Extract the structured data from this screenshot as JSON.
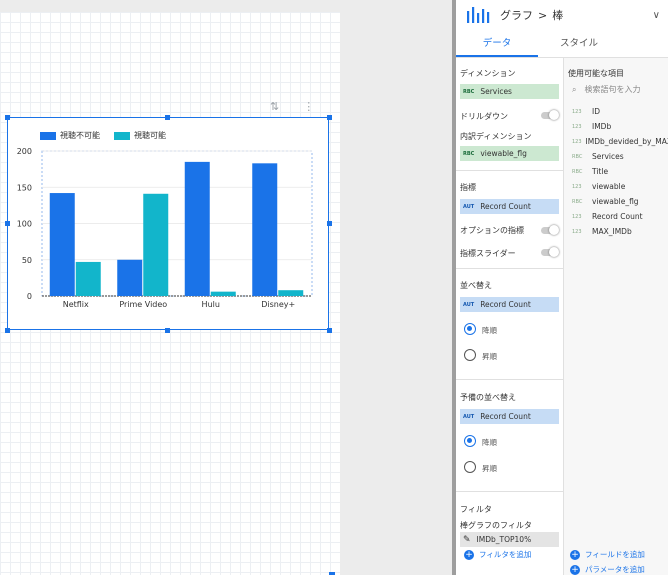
{
  "chart_data": {
    "type": "bar",
    "categories": [
      "Netflix",
      "Prime Video",
      "Hulu",
      "Disney+"
    ],
    "series": [
      {
        "name": "視聴不可能",
        "values": [
          142,
          50,
          185,
          183
        ],
        "color": "#1a73e8"
      },
      {
        "name": "視聴可能",
        "values": [
          47,
          141,
          6,
          8
        ],
        "color": "#12b5cb"
      }
    ],
    "yticks": [
      0,
      50,
      100,
      150,
      200
    ],
    "ylim": [
      0,
      200
    ],
    "legend_position": "top-left"
  },
  "panel": {
    "breadcrumb_chart": "グラフ",
    "breadcrumb_sep": ">",
    "breadcrumb_type": "棒",
    "tabs": [
      "データ",
      "スタイル"
    ],
    "dimension_title": "ディメンション",
    "dimension_value": "Services",
    "drilldown_label": "ドリルダウン",
    "breakdown_title": "内訳ディメンション",
    "breakdown_value": "viewable_flg",
    "metric_title": "指標",
    "metric_value": "Record Count",
    "optional_metric_label": "オプションの指標",
    "metric_slider_label": "指標スライダー",
    "sort_title": "並べ替え",
    "sort_value": "Record Count",
    "sort_desc": "降順",
    "sort_asc": "昇順",
    "secondary_sort_title": "予備の並べ替え",
    "secondary_sort_value": "Record Count",
    "secondary_desc": "降順",
    "secondary_asc": "昇順",
    "filter_title": "フィルタ",
    "bar_filter_title": "棒グラフのフィルタ",
    "filter_value": "IMDb_TOP10%",
    "add_filter": "フィルタを追加",
    "available_title": "使用可能な項目",
    "search_placeholder": "検索語句を入力",
    "fields": [
      {
        "tag": "123",
        "name": "ID"
      },
      {
        "tag": "123",
        "name": "IMDb"
      },
      {
        "tag": "123",
        "name": "IMDb_devided_by_MAX"
      },
      {
        "tag": "RBC",
        "name": "Services"
      },
      {
        "tag": "RBC",
        "name": "Title"
      },
      {
        "tag": "123",
        "name": "viewable"
      },
      {
        "tag": "RBC",
        "name": "viewable_flg"
      },
      {
        "tag": "123",
        "name": "Record Count"
      },
      {
        "tag": "123",
        "name": "MAX_IMDb"
      }
    ],
    "add_field": "フィールドを追加",
    "add_parameter": "パラメータを追加",
    "tag_rbc": "RBC",
    "tag_aut": "AUT"
  },
  "colors": {
    "accent": "#1a73e8",
    "teal": "#12b5cb"
  },
  "icons": [
    "bar-chart-icon",
    "chevron-down-icon",
    "search-icon",
    "pencil-icon",
    "plus-icon",
    "sort-icon",
    "more-vert-icon"
  ]
}
